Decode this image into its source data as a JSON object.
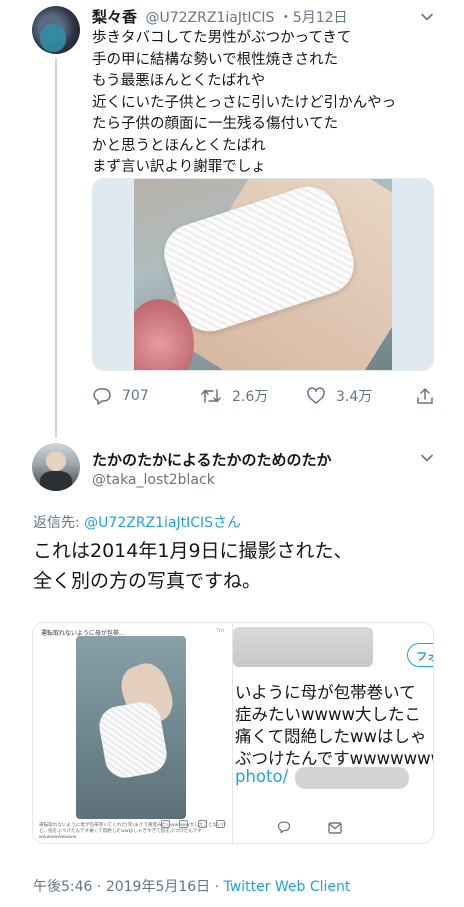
{
  "tweet1": {
    "display_name": "梨々香",
    "handle": "@U72ZRZ1iaJtICIS",
    "date": "・5月12日",
    "text_lines": [
      "歩きタバコしてた男性がぶつかってきて",
      "手の甲に結構な勢いで根性焼きされた",
      "もう最悪ほんとくたばれや",
      "近くにいた子供とっさに引いたけど引かんやっ",
      "たら子供の顔面に一生残る傷付いてた",
      "かと思うとほんとくたばれ",
      "まず言い訳より謝罪でしょ"
    ],
    "reply_count": "707",
    "retweet_count": "2.6万",
    "like_count": "3.4万"
  },
  "tweet2": {
    "display_name": "たかのたかによるたかのためのたか",
    "handle": "@taka_lost2black",
    "reply_prefix": "返信先: ",
    "reply_mention": "@U72ZRZ1iaJtICISさん",
    "text_lines": [
      "これは2014年1月9日に撮影された、",
      "全く別の方の写真ですね。"
    ],
    "embedded_left": {
      "title": "運転取れないように母が包帯...",
      "time": "7m",
      "caption": "運転取れないように母が包帯巻いてくれた(笑)まさで重症みたいwwwww大したことないけど、指をぶつけたんです痛くて悶絶したwwはしゃぎすぎて指をぶつけたんですwwwwwwwwww"
    },
    "embedded_right": {
      "follow_label": "フォ",
      "lines": [
        "いように母が包帯巻いて",
        "症みたいwwww大したこ",
        "痛くて悶絶したwwはしゃ",
        "ぶつけたんですwwwwwww"
      ],
      "link_text": "photo/"
    },
    "time": "午後5:46",
    "separator": " · ",
    "date": "2019年5月16日",
    "client": "Twitter Web Client"
  },
  "colors": {
    "accent": "#1da1f2",
    "secondary_text": "#657786",
    "primary_text": "#14171a",
    "border": "#e1e8ed"
  },
  "icons": [
    "chevron-down-icon",
    "reply-icon",
    "retweet-icon",
    "like-icon",
    "share-icon",
    "mail-icon"
  ]
}
